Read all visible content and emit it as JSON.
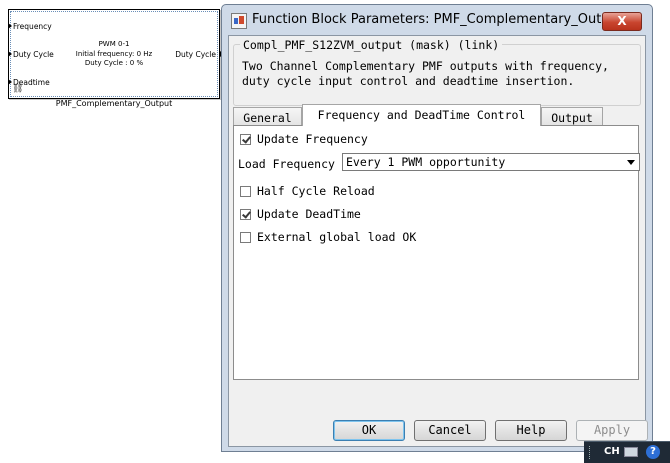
{
  "block": {
    "name": "PMF_Complementary_Output",
    "inputs": [
      "Frequency",
      "Duty Cycle",
      "Deadtime"
    ],
    "output": "Duty Cycle",
    "center_lines": [
      "PWM 0-1",
      "Initial frequency: 0 Hz",
      "Duty Cycle : 0 %"
    ]
  },
  "dialog": {
    "title": "Function Block Parameters: PMF_Complementary_Output",
    "close_label": "X",
    "mask_title": "Compl_PMF_S12ZVM_output (mask) (link)",
    "description_lines": [
      "Two Channel Complementary PMF outputs with frequency,",
      "duty cycle input control and deadtime insertion."
    ],
    "tabs": [
      "General",
      "Frequency and DeadTime Control",
      "Output"
    ],
    "active_tab": "Frequency and DeadTime Control",
    "params": {
      "update_frequency": {
        "label": "Update Frequency",
        "checked": true
      },
      "load_frequency": {
        "label": "Load Frequency",
        "value": "Every 1 PWM opportunity"
      },
      "half_cycle_reload": {
        "label": "Half Cycle Reload",
        "checked": false
      },
      "update_deadtime": {
        "label": "Update DeadTime",
        "checked": true
      },
      "external_global_load": {
        "label": "External global load OK",
        "checked": false
      }
    },
    "buttons": {
      "ok": "OK",
      "cancel": "Cancel",
      "help": "Help",
      "apply": "Apply"
    }
  },
  "taskbar": {
    "language": "CH",
    "help_glyph": "?"
  }
}
